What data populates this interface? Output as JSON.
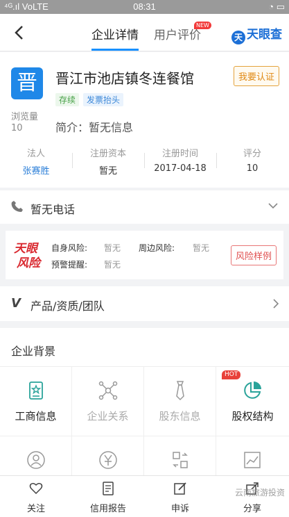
{
  "status_bar": {
    "left": "⁴ᴳ.ıl VoLTE",
    "time": "08:31",
    "right": "◔ ▭"
  },
  "nav": {
    "tab_active": "企业详情",
    "tab_other": "用户评价",
    "new_badge": "NEW",
    "logo_text": "天眼查",
    "logo_mark": "天"
  },
  "company": {
    "avatar_char": "晋",
    "views_label": "浏览量",
    "views_value": "10",
    "name": "晋江市池店镇冬连餐馆",
    "verify_button": "我要认证",
    "tag_status": "存续",
    "tag_invoice": "发票抬头",
    "intro": "简介：暂无信息",
    "stats": [
      {
        "label": "法人",
        "value": "张赛胜"
      },
      {
        "label": "注册资本",
        "value": "暂无"
      },
      {
        "label": "注册时间",
        "value": "2017-04-18"
      },
      {
        "label": "评分",
        "value": "10"
      }
    ]
  },
  "phone": {
    "text": "暂无电话"
  },
  "risk": {
    "logo_line1": "天眼",
    "logo_line2": "风险",
    "self_risk_label": "自身风险:",
    "self_risk_value": "暂无",
    "around_risk_label": "周边风险:",
    "around_risk_value": "暂无",
    "warning_label": "预警提醒:",
    "warning_value": "暂无",
    "sample_button": "风险样例"
  },
  "products": {
    "text": "产品/资质/团队"
  },
  "background": {
    "title": "企业背景",
    "items": [
      {
        "label": "工商信息",
        "icon": "business-info-icon"
      },
      {
        "label": "企业关系",
        "icon": "relation-icon"
      },
      {
        "label": "股东信息",
        "icon": "shareholder-icon"
      },
      {
        "label": "股权结构",
        "icon": "equity-structure-icon",
        "badge": "HOT"
      }
    ]
  },
  "bottom_bar": [
    {
      "label": "关注",
      "icon": "heart-icon"
    },
    {
      "label": "信用报告",
      "icon": "report-icon"
    },
    {
      "label": "申诉",
      "icon": "edit-icon"
    },
    {
      "label": "分享",
      "icon": "share-icon"
    }
  ],
  "watermark": "云南旅游投资",
  "colors": {
    "accent": "#1890ff",
    "avatar": "#1f88e8",
    "hot": "#e8413a",
    "verify": "#e08a15"
  }
}
